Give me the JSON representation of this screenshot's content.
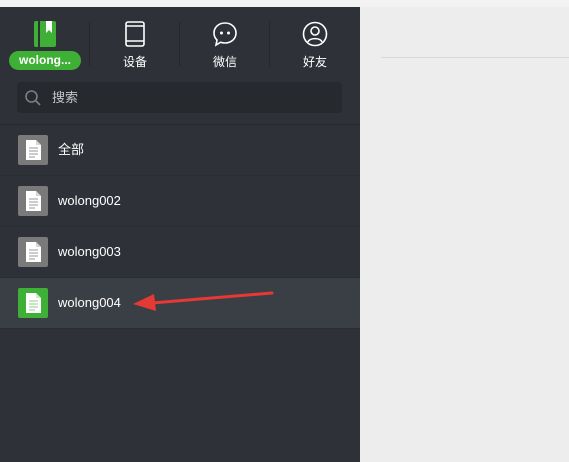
{
  "nav": {
    "user": {
      "label": "wolong..."
    },
    "devices": {
      "label": "设备"
    },
    "wechat": {
      "label": "微信"
    },
    "friends": {
      "label": "好友"
    }
  },
  "search": {
    "placeholder": "搜索"
  },
  "list": [
    {
      "name": "全部",
      "active": false,
      "icon": "file-icon"
    },
    {
      "name": "wolong002",
      "active": false,
      "icon": "file-icon"
    },
    {
      "name": "wolong003",
      "active": false,
      "icon": "file-icon"
    },
    {
      "name": "wolong004",
      "active": true,
      "icon": "file-icon"
    }
  ],
  "colors": {
    "sidebar": "#2e3238",
    "accent_green": "#3db035",
    "file_icon_gray": "#7a7a7a",
    "annotation_arrow": "#e53935"
  }
}
